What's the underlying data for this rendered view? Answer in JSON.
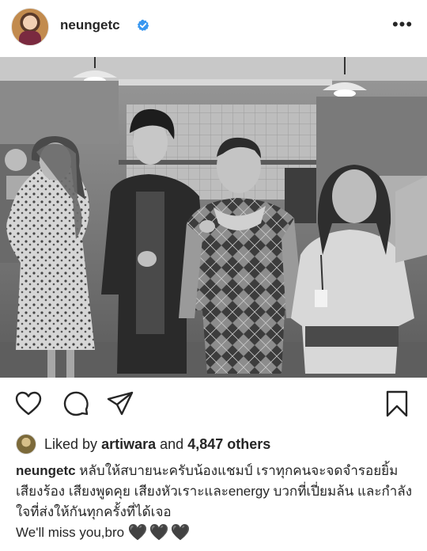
{
  "post": {
    "username": "neungetc",
    "verified_icon": "verified-badge-icon",
    "more_icon": "more-options-icon",
    "more_label": "•••"
  },
  "actions": {
    "like_icon": "heart-outline-icon",
    "comment_icon": "comment-icon",
    "share_icon": "send-icon",
    "save_icon": "bookmark-icon"
  },
  "likes": {
    "prefix": "Liked by",
    "user": "artiwara",
    "middle": "and",
    "count": "4,847 others"
  },
  "caption": {
    "username": "neungetc",
    "text": "หลับให้สบายนะครับน้องแชมป์ เราทุกคนจะจดจำรอยยิ้ม เสียงร้อง เสียงพูดคุย เสียงหัวเราะและenergy บวกที่เปี่ยมล้น และกำลังใจที่ส่งให้กันทุกครั้งที่ได้เจอ",
    "line2": "We'll miss you,bro",
    "hearts": "🖤🖤🖤"
  },
  "colors": {
    "text": "#262626",
    "verified": "#3897f0",
    "background": "#ffffff"
  }
}
